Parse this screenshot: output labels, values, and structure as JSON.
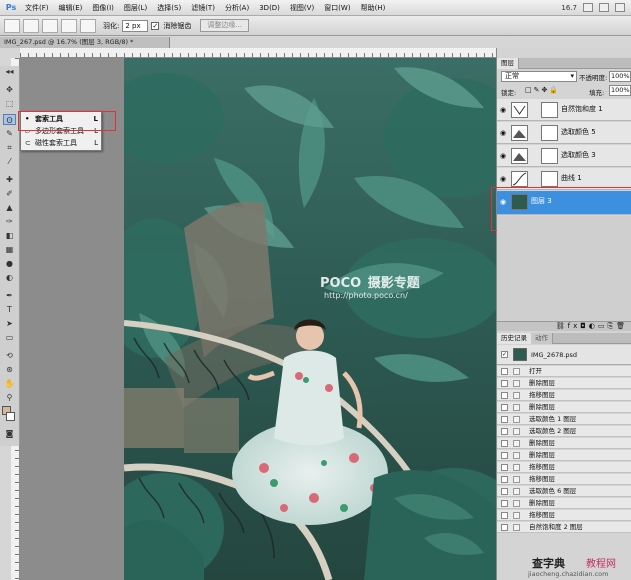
{
  "app": {
    "logo": "Ps",
    "menu": [
      "文件(F)",
      "编辑(E)",
      "图像(I)",
      "图层(L)",
      "选择(S)",
      "滤镜(T)",
      "分析(A)",
      "3D(D)",
      "视图(V)",
      "窗口(W)",
      "帮助(H)"
    ],
    "zoom": "16.7"
  },
  "options": {
    "feather_label": "羽化:",
    "feather_value": "2 px",
    "antialias_label": "消除锯齿",
    "antialias_check": "✓",
    "refine_edge": "调整边缘..."
  },
  "document": {
    "tab_title": "IMG_267.psd @ 16.7% (图层 3, RGB/8) *"
  },
  "flyout": {
    "items": [
      {
        "bullet": "•",
        "label": "套索工具",
        "key": "L"
      },
      {
        "bullet": "",
        "label": "多边形套索工具",
        "key": "L"
      },
      {
        "bullet": "",
        "label": "磁性套索工具",
        "key": "L"
      }
    ]
  },
  "watermark": {
    "brand": "POCO",
    "title": "摄影专题",
    "url": "http://photo.poco.cn/"
  },
  "layers": {
    "tab": "图层",
    "blend_mode": "正常",
    "opacity_label": "不透明度:",
    "opacity_value": "100%",
    "lock_label": "锁定:",
    "fill_label": "填充:",
    "fill_value": "100%",
    "items": [
      {
        "name": "自然饱和度 1"
      },
      {
        "name": "选取颜色 5"
      },
      {
        "name": "选取颜色 3"
      },
      {
        "name": "曲线 1"
      },
      {
        "name": "图层 3"
      }
    ]
  },
  "history": {
    "tabs": [
      "历史记录",
      "动作"
    ],
    "snapshot": "IMG_2678.psd",
    "items": [
      "打开",
      "删除图层",
      "拖移图层",
      "删除图层",
      "选取颜色 1 图层",
      "选取颜色 2 图层",
      "删除图层",
      "删除图层",
      "拖移图层",
      "拖移图层",
      "选取颜色 6 图层",
      "删除图层",
      "拖移图层",
      "自然饱和度 2 图层"
    ]
  },
  "site_watermark": {
    "name": "查字典",
    "sub": "教程网",
    "url": "jiaocheng.chazidian.com"
  }
}
